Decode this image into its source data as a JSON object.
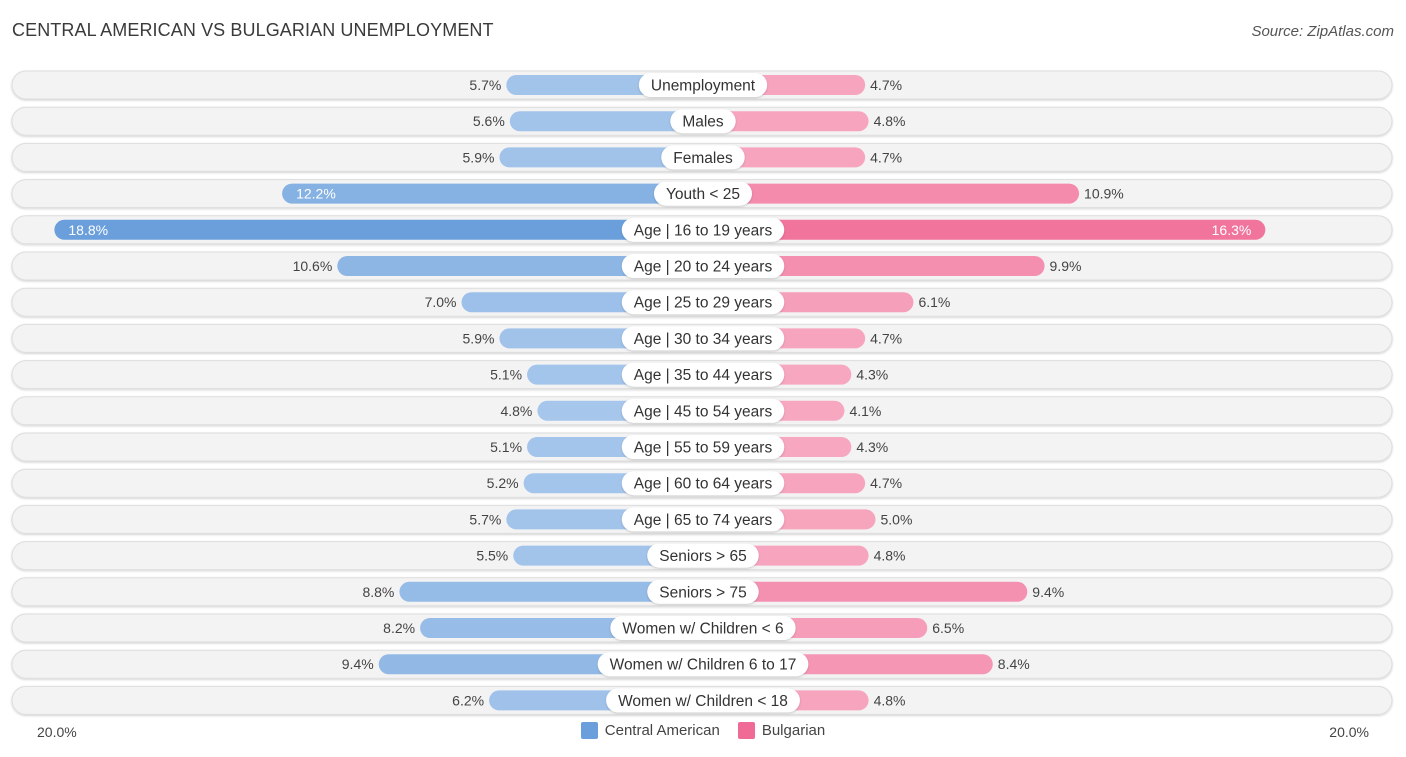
{
  "header": {
    "title": "CENTRAL AMERICAN VS BULGARIAN UNEMPLOYMENT",
    "source": "Source: ZipAtlas.com"
  },
  "axis": {
    "left_label": "20.0%",
    "right_label": "20.0%"
  },
  "legend": {
    "items": [
      {
        "label": "Central American",
        "color": "#6a9fdc"
      },
      {
        "label": "Bulgarian",
        "color": "#f06a96"
      }
    ]
  },
  "chart_data": {
    "type": "bar",
    "orientation": "horizontal-diverging",
    "title": "CENTRAL AMERICAN VS BULGARIAN UNEMPLOYMENT",
    "xlabel": "",
    "ylabel": "",
    "xlim": [
      -20.0,
      20.0
    ],
    "unit": "%",
    "legend_position": "bottom",
    "categories": [
      "Unemployment",
      "Males",
      "Females",
      "Youth < 25",
      "Age | 16 to 19 years",
      "Age | 20 to 24 years",
      "Age | 25 to 29 years",
      "Age | 30 to 34 years",
      "Age | 35 to 44 years",
      "Age | 45 to 54 years",
      "Age | 55 to 59 years",
      "Age | 60 to 64 years",
      "Age | 65 to 74 years",
      "Seniors > 65",
      "Seniors > 75",
      "Women w/ Children < 6",
      "Women w/ Children 6 to 17",
      "Women w/ Children < 18"
    ],
    "series": [
      {
        "name": "Central American",
        "side": "left",
        "color": "#6a9fdc",
        "values": [
          5.7,
          5.6,
          5.9,
          12.2,
          18.8,
          10.6,
          7.0,
          5.9,
          5.1,
          4.8,
          5.1,
          5.2,
          5.7,
          5.5,
          8.8,
          8.2,
          9.4,
          6.2
        ]
      },
      {
        "name": "Bulgarian",
        "side": "right",
        "color": "#f06a96",
        "values": [
          4.7,
          4.8,
          4.7,
          10.9,
          16.3,
          9.9,
          6.1,
          4.7,
          4.3,
          4.1,
          4.3,
          4.7,
          5.0,
          4.8,
          9.4,
          6.5,
          8.4,
          4.8
        ]
      }
    ]
  }
}
